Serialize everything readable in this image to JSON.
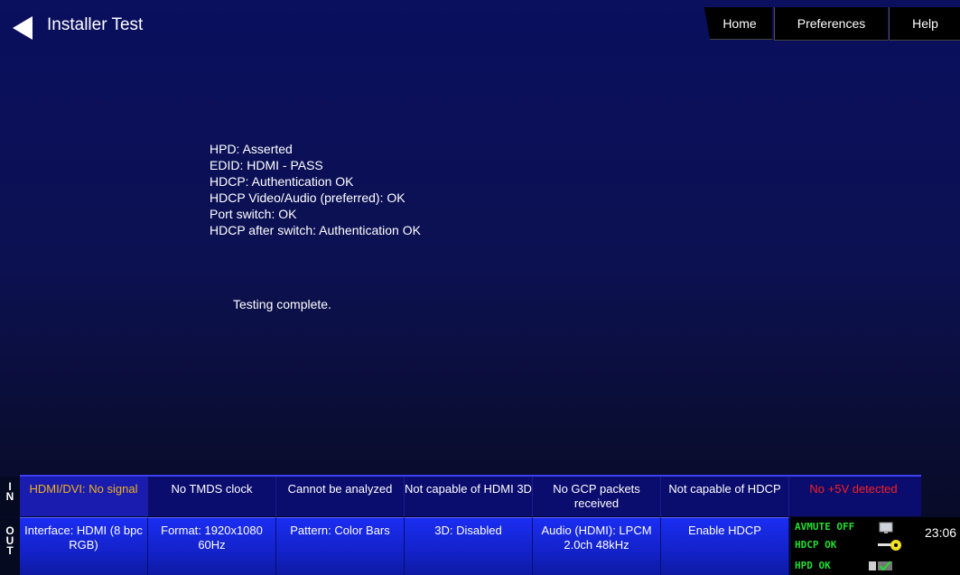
{
  "header": {
    "title": "Installer Test",
    "nav": {
      "home": "Home",
      "preferences": "Preferences",
      "help": "Help"
    }
  },
  "results": [
    "HPD: Asserted",
    "EDID: HDMI - PASS",
    "HDCP: Authentication OK",
    "HDCP Video/Audio (preferred): OK",
    "Port switch: OK",
    "HDCP after switch: Authentication OK"
  ],
  "status_message": "Testing complete.",
  "in_row": {
    "label": "IN",
    "cells": [
      "HDMI/DVI: No signal",
      "No TMDS clock",
      "Cannot be analyzed",
      "Not capable of HDMI 3D",
      "No GCP packets received",
      "Not capable of HDCP",
      "No +5V detected"
    ]
  },
  "out_row": {
    "label": "OUT",
    "cells": [
      "Interface: HDMI (8 bpc RGB)",
      "Format: 1920x1080 60Hz",
      "Pattern: Color Bars",
      "3D: Disabled",
      "Audio (HDMI): LPCM 2.0ch 48kHz",
      "Enable HDCP"
    ]
  },
  "status_panel": {
    "avmute": "AVMUTE OFF",
    "hdcp": "HDCP OK",
    "hpd": "HPD OK",
    "time": "23:06"
  },
  "colors": {
    "in_first_text": "#f0b020",
    "in_error_text": "#ff1e1e",
    "status_green": "#22dd33",
    "out_button_blue": "#1b2df2"
  },
  "icons": [
    "back-arrow-icon",
    "monitor-icon",
    "key-icon",
    "hpd-connector-icon"
  ]
}
